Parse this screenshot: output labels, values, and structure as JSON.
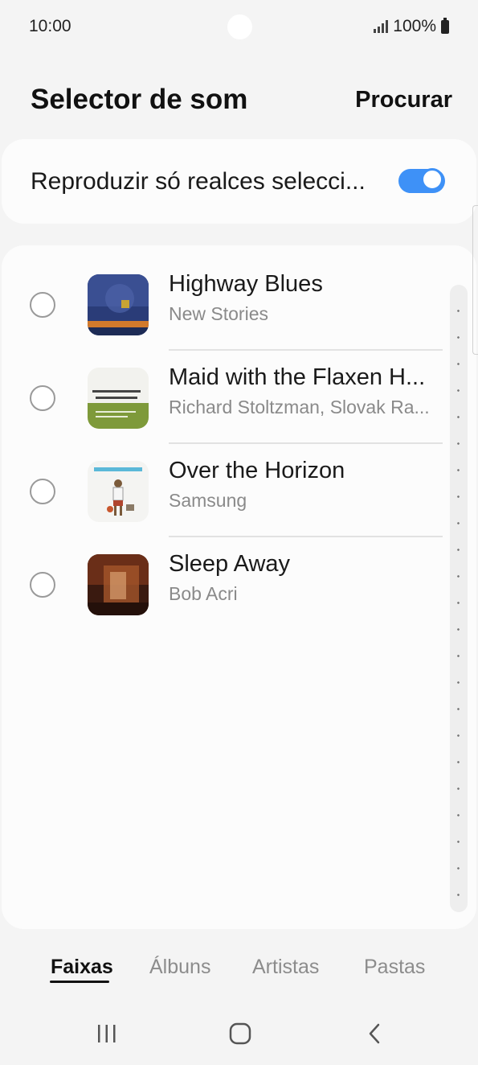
{
  "status": {
    "time": "10:00",
    "battery": "100%"
  },
  "header": {
    "title": "Selector de som",
    "search_label": "Procurar"
  },
  "toggle_row": {
    "label": "Reproduzir só realces selecci...",
    "enabled": true,
    "accent_color": "#3e91f7"
  },
  "tracks": [
    {
      "title": "Highway Blues",
      "artist": "New Stories",
      "selected": false,
      "art_icon": "album-art-highway-blues"
    },
    {
      "title": "Maid with the Flaxen H...",
      "artist": "Richard Stoltzman, Slovak Ra...",
      "selected": false,
      "art_icon": "album-art-maid-flaxen-hair"
    },
    {
      "title": "Over the Horizon",
      "artist": "Samsung",
      "selected": false,
      "art_icon": "album-art-over-horizon"
    },
    {
      "title": "Sleep Away",
      "artist": "Bob Acri",
      "selected": false,
      "art_icon": "album-art-sleep-away"
    }
  ],
  "tabs": [
    {
      "label": "Faixas",
      "active": true
    },
    {
      "label": "Álbuns",
      "active": false
    },
    {
      "label": "Artistas",
      "active": false
    },
    {
      "label": "Pastas",
      "active": false
    }
  ],
  "nav": {
    "recents_icon": "recents-icon",
    "home_icon": "home-icon",
    "back_icon": "back-icon"
  }
}
